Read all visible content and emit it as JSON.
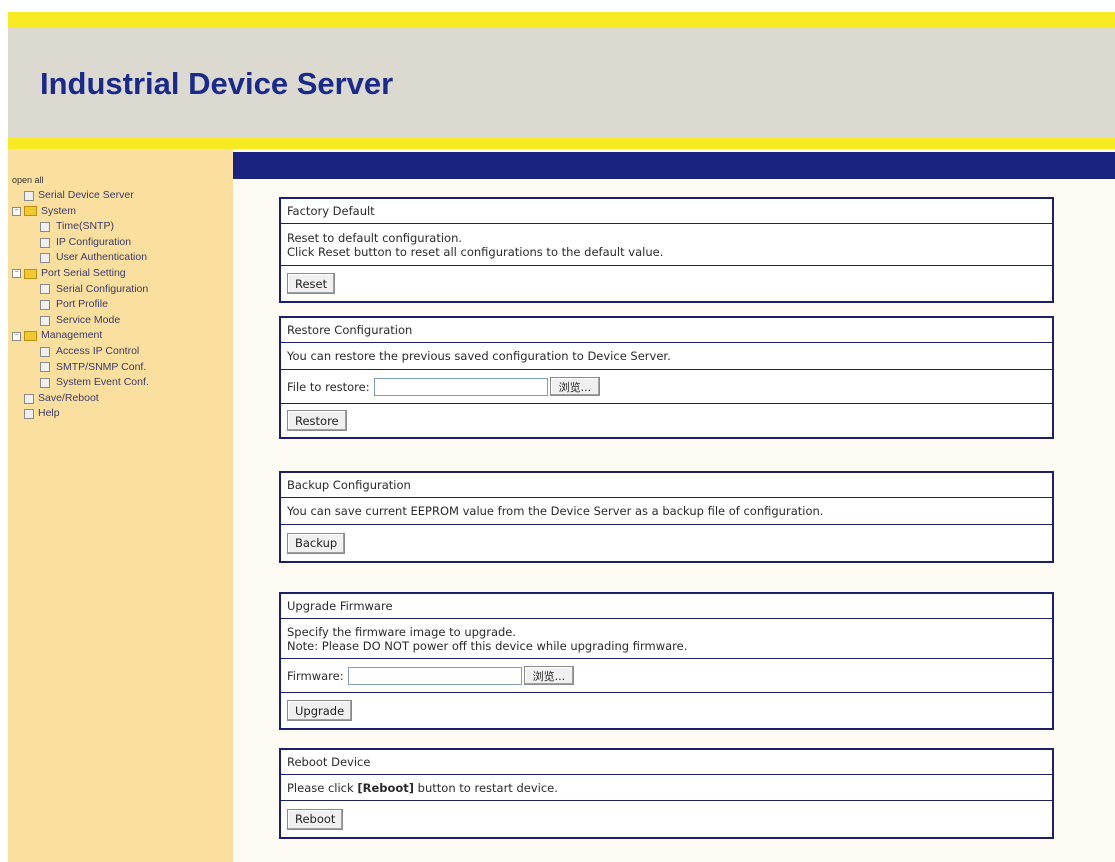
{
  "header": {
    "title": "Industrial Device Server"
  },
  "sidebar": {
    "open_all": "open all",
    "items": [
      {
        "label": "Serial Device Server"
      },
      {
        "label": "System",
        "toggle": "−"
      },
      {
        "label": "Time(SNTP)"
      },
      {
        "label": "IP Configuration"
      },
      {
        "label": "User Authentication"
      },
      {
        "label": "Port Serial Setting",
        "toggle": "−"
      },
      {
        "label": "Serial Configuration"
      },
      {
        "label": "Port Profile"
      },
      {
        "label": "Service Mode"
      },
      {
        "label": "Management",
        "toggle": "−"
      },
      {
        "label": "Access IP Control"
      },
      {
        "label": "SMTP/SNMP Conf."
      },
      {
        "label": "System Event Conf."
      },
      {
        "label": "Save/Reboot"
      },
      {
        "label": "Help"
      }
    ]
  },
  "factory_default": {
    "title": "Factory Default",
    "line1": "Reset to default configuration.",
    "line2": "Click Reset button to reset all configurations to the default value.",
    "button": "Reset"
  },
  "restore": {
    "title": "Restore Configuration",
    "desc": "You can restore the previous saved configuration to Device Server.",
    "file_label": "File to restore:",
    "browse": "浏览...",
    "button": "Restore"
  },
  "backup": {
    "title": "Backup Configuration",
    "desc": "You can save current EEPROM value from the Device Server as a backup file of configuration.",
    "button": "Backup"
  },
  "upgrade": {
    "title": "Upgrade Firmware",
    "line1": "Specify the firmware image to upgrade.",
    "line2": "Note: Please DO NOT power off this device while upgrading firmware.",
    "file_label": "Firmware:",
    "browse": "浏览...",
    "button": "Upgrade"
  },
  "reboot": {
    "title": "Reboot Device",
    "desc_pre": "Please click ",
    "desc_bold": "[Reboot]",
    "desc_post": " button to restart device.",
    "button": "Reboot"
  },
  "colors": {
    "header_stripe": "#f7ea22",
    "header_bg": "#dcdad0",
    "title_text": "#1a2a8c",
    "sidebar_bg": "#fbdf9e",
    "main_bar": "#1a2380",
    "panel_border": "#1a1f6e"
  },
  "icons": {
    "page": "page-icon",
    "folder": "folder-icon",
    "toggle": "collapse-toggle-icon"
  }
}
